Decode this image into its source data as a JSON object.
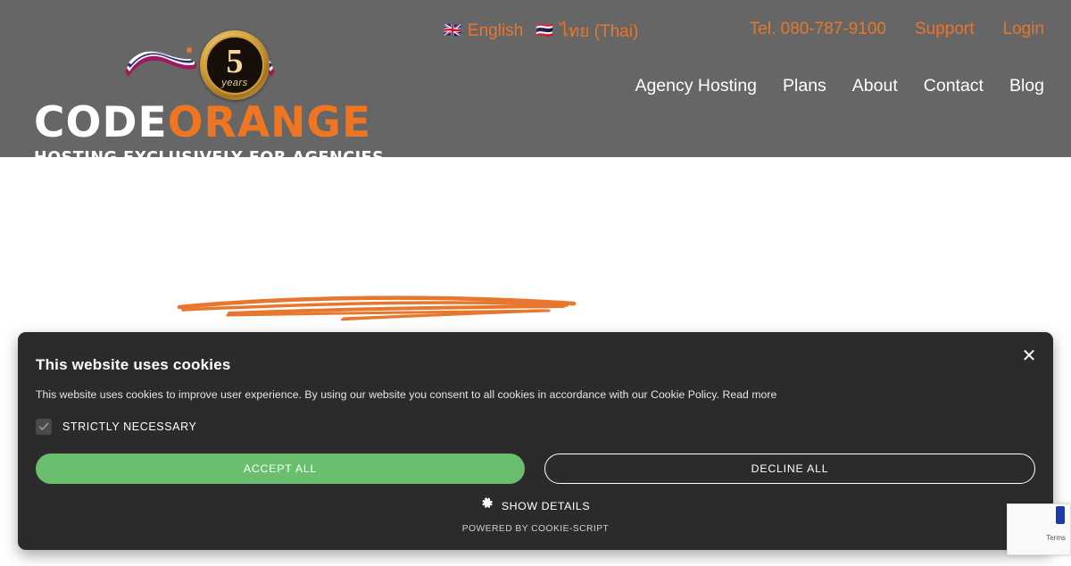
{
  "header": {
    "logo": {
      "badge_number": "5",
      "badge_label": "years",
      "wordmark_primary": "CODE",
      "wordmark_secondary": "ORANGE",
      "tagline": "HOSTING EXCLUSIVELY FOR AGENCIES",
      "flag_left": "🇹🇭",
      "flag_right": "🇹🇭"
    },
    "languages": [
      {
        "flag": "🇬🇧",
        "label": "English",
        "icon": "uk-flag-icon"
      },
      {
        "flag": "🇹🇭",
        "label": "ไทย (Thai)",
        "icon": "thai-flag-icon"
      }
    ],
    "utility_links": [
      {
        "label": "Tel. 080-787-9100"
      },
      {
        "label": "Support"
      },
      {
        "label": "Login"
      }
    ],
    "nav_links": [
      {
        "label": "Agency Hosting"
      },
      {
        "label": "Plans"
      },
      {
        "label": "About"
      },
      {
        "label": "Contact"
      },
      {
        "label": "Blog"
      }
    ]
  },
  "cookie_banner": {
    "title": "This website uses cookies",
    "description": "This website uses cookies to improve user experience. By using our website you consent to all cookies in accordance with our Cookie Policy.",
    "read_more": "Read more",
    "category_label": "STRICTLY NECESSARY",
    "category_checked": true,
    "accept_label": "ACCEPT ALL",
    "decline_label": "DECLINE ALL",
    "show_details_label": "SHOW DETAILS",
    "powered_by": "POWERED BY COOKIE-SCRIPT",
    "close_label": "✕"
  },
  "recaptcha": {
    "terms_label": "Terms"
  },
  "colors": {
    "header_bg": "#666666",
    "accent_orange": "#e8762c",
    "logo_orange": "#ee7623",
    "banner_bg": "#2b2b2b",
    "accept_green": "#6abf6e",
    "page_bg": "#ffffff"
  }
}
